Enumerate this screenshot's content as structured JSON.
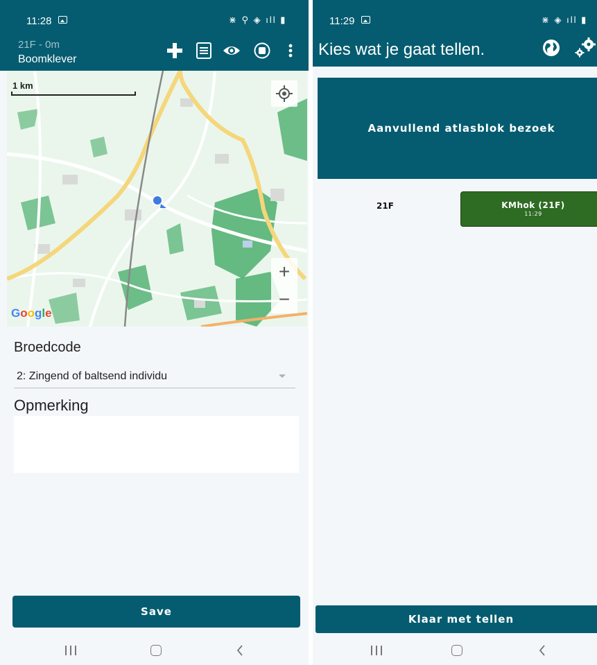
{
  "left": {
    "status": {
      "time": "11:28",
      "sysicons": "⋇ ⚲ ◈ ıll ▮"
    },
    "appbar": {
      "subtitle": "21F - 0m",
      "title": "Boomklever",
      "icons": [
        "plus-icon",
        "list-icon",
        "eye-icon",
        "stop-icon",
        "more-vert-icon"
      ]
    },
    "map": {
      "scale_label": "1 km",
      "zoom_in": "+",
      "zoom_out": "−",
      "google_letters": [
        "G",
        "o",
        "o",
        "g",
        "l",
        "e"
      ],
      "google_colors": [
        "#4285f4",
        "#ea4335",
        "#fbbc05",
        "#4285f4",
        "#34a853",
        "#ea4335"
      ]
    },
    "form": {
      "broedcode_label": "Broedcode",
      "broedcode_value": "2: Zingend of baltsend individu",
      "opmerking_label": "Opmerking",
      "opmerking_value": ""
    },
    "save_label": "Save"
  },
  "right": {
    "status": {
      "time": "11:29",
      "sysicons": "⋇ ◈ ıll ▮"
    },
    "appbar": {
      "title": "Kies wat je gaat tellen.",
      "icons": [
        "globe-icon",
        "settings-gears-icon"
      ]
    },
    "tile_label": "Aanvullend atlasblok bezoek",
    "code": "21F",
    "kmhok": {
      "name": "KMhok (21F)",
      "time": "11:29"
    },
    "klaar_label": "Klaar met tellen"
  },
  "colors": {
    "primary": "#055c70",
    "green": "#2e6b23",
    "background": "#f4f7fa"
  }
}
